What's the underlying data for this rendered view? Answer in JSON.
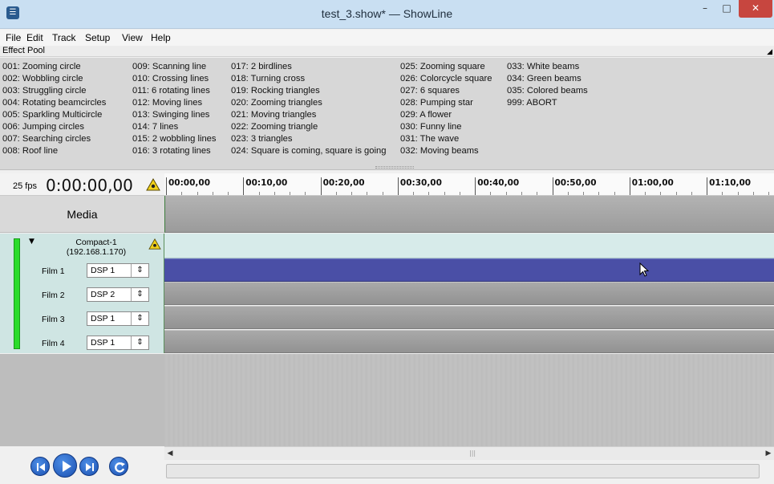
{
  "window": {
    "title": "test_3.show* — ShowLine",
    "min_label": "–",
    "max_label": "□",
    "close_label": "✕"
  },
  "menu": [
    "File",
    "Edit",
    "Track",
    "Setup",
    "View",
    "Help"
  ],
  "effect_pool": {
    "title": "Effect Pool",
    "columns": [
      [
        "001: Zooming circle",
        "002: Wobbling circle",
        "003: Struggling circle",
        "004: Rotating beamcircles",
        "005: Sparkling Multicircle",
        "006: Jumping circles",
        "007: Searching circles",
        "008: Roof line"
      ],
      [
        "009: Scanning line",
        "010: Crossing lines",
        "011: 6 rotating lines",
        "012: Moving lines",
        "013: Swinging lines",
        "014: 7 lines",
        "015: 2 wobbling lines",
        "016: 3 rotating lines"
      ],
      [
        "017: 2 birdlines",
        "018: Turning cross",
        "019: Rocking triangles",
        "020: Zooming triangles",
        "021: Moving triangles",
        "022: Zooming triangle",
        "023: 3 triangles",
        "024: Square is coming, square is going"
      ],
      [
        "025: Zooming square",
        "026: Colorcycle square",
        "027: 6 squares",
        "028: Pumping star",
        "029: A flower",
        "030: Funny line",
        "031: The wave",
        "032: Moving beams"
      ],
      [
        "033: White beams",
        "034: Green beams",
        "035: Colored beams",
        "999: ABORT"
      ]
    ]
  },
  "timeline": {
    "fps": "25 fps",
    "timecode": "0:00:00,00",
    "ruler_labels": [
      "00:00,00",
      "00:10,00",
      "00:20,00",
      "00:30,00",
      "00:40,00",
      "00:50,00",
      "01:00,00",
      "01:10,00"
    ]
  },
  "media": {
    "label": "Media"
  },
  "device": {
    "name": "Compact-1",
    "ip": "(192.168.1.170)",
    "films": [
      {
        "label": "Film 1",
        "dsp": "DSP 1"
      },
      {
        "label": "Film 2",
        "dsp": "DSP 2"
      },
      {
        "label": "Film 3",
        "dsp": "DSP 1"
      },
      {
        "label": "Film 4",
        "dsp": "DSP 1"
      }
    ],
    "active_film_index": 0
  },
  "colors": {
    "status_green": "#2bdc2b",
    "active_lane": "#4a4fa6",
    "warning_yellow": "#f2d21a",
    "transport_blue": "#1a4fb0"
  },
  "transport": {
    "icons": [
      "rewind-icon",
      "play-icon",
      "forward-icon",
      "repeat-icon"
    ]
  }
}
